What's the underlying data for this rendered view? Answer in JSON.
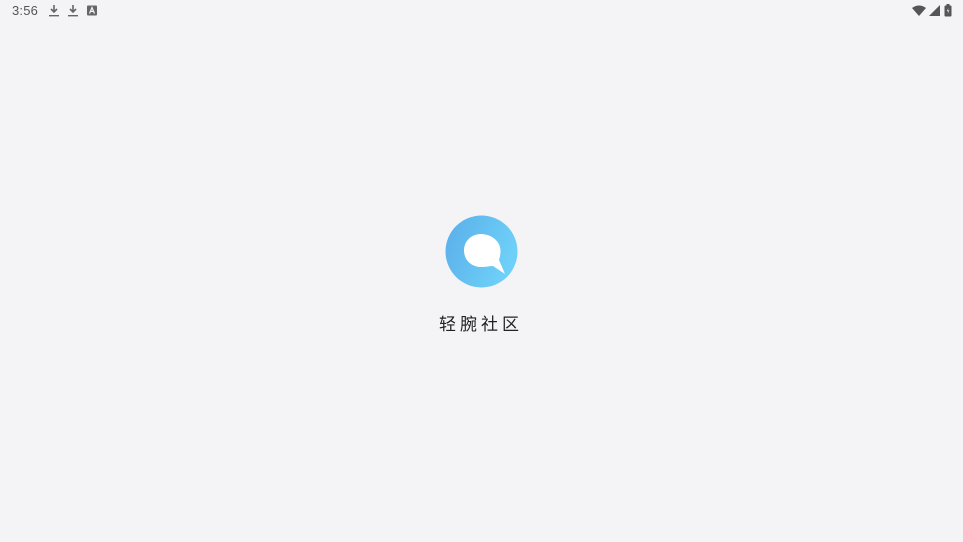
{
  "status_bar": {
    "time": "3:56",
    "left_icons": [
      "download-icon",
      "download-icon",
      "font-a-icon"
    ],
    "right_icons": [
      "wifi-icon",
      "signal-icon",
      "battery-icon"
    ]
  },
  "splash": {
    "app_name": "轻腕社区",
    "logo_icon": "speech-bubble-logo-icon",
    "colors": {
      "logo_gradient_start": "#5aaee9",
      "logo_gradient_end": "#6ed0f8",
      "background": "#f4f4f6"
    }
  }
}
